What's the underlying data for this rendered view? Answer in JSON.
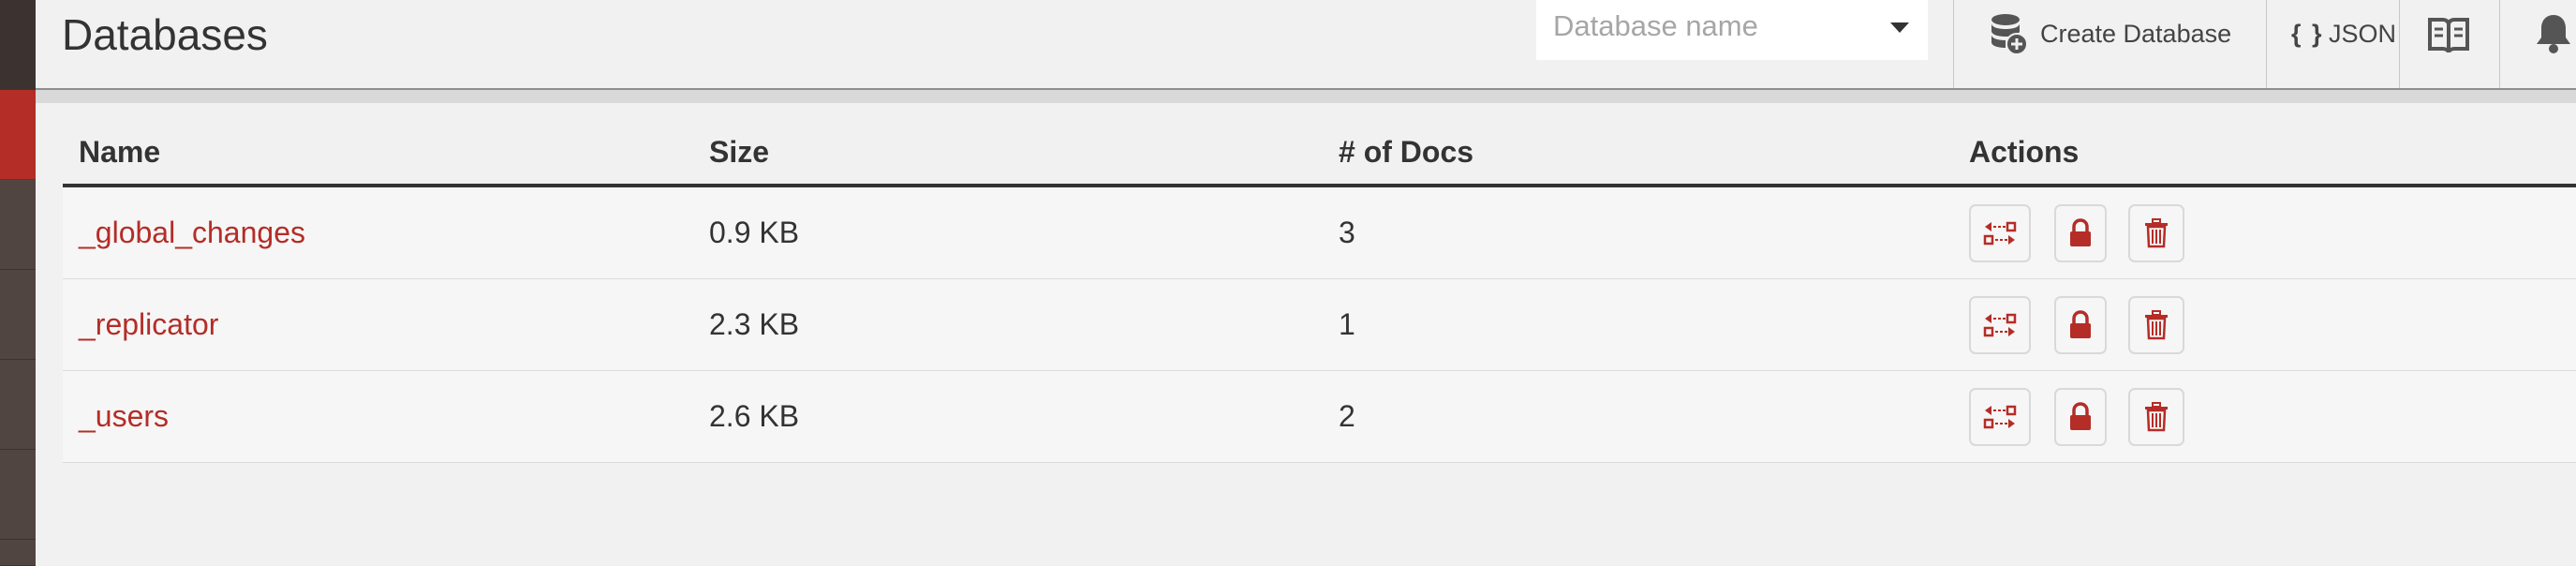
{
  "header": {
    "title": "Databases",
    "search": {
      "placeholder": "Database name"
    },
    "create_label": "Create Database",
    "json_label": "JSON",
    "icons": [
      "database-plus-icon",
      "book-icon",
      "bell-icon"
    ]
  },
  "table": {
    "columns": [
      "Name",
      "Size",
      "# of Docs",
      "Actions"
    ],
    "rows": [
      {
        "name": "_global_changes",
        "size": "0.9 KB",
        "docs": "3"
      },
      {
        "name": "_replicator",
        "size": "2.3 KB",
        "docs": "1"
      },
      {
        "name": "_users",
        "size": "2.6 KB",
        "docs": "2"
      }
    ],
    "row_actions": [
      "replicate-icon",
      "lock-icon",
      "trash-icon"
    ]
  },
  "colors": {
    "accent": "#b42d27",
    "sidebar": "#514542",
    "background": "#f1f1f1"
  }
}
